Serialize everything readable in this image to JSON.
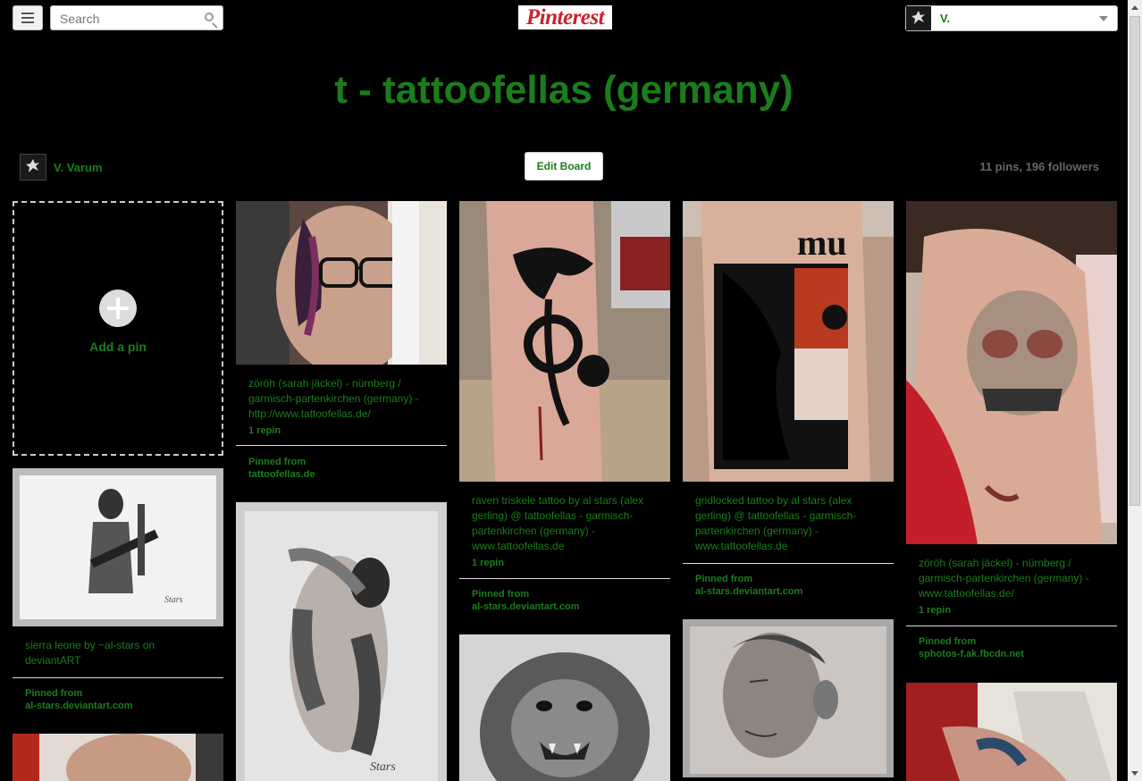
{
  "header": {
    "search_placeholder": "Search",
    "logo_text": "Pinterest",
    "user_menu_name": "V."
  },
  "board": {
    "title": "t - tattoofellas (germany)",
    "owner_name": "V. Varum",
    "edit_label": "Edit Board",
    "stats": "11 pins, 196 followers"
  },
  "add_pin_label": "Add a pin",
  "pins": [
    {
      "description": "zöröh (sarah jäckel) - nürnberg / garmisch-partenkirchen (germany) - http://www.tattoofellas.de/",
      "repins": "1 repin",
      "pinned_from_label": "Pinned from",
      "pinned_from_source": "tattoofellas.de"
    },
    {
      "description": "raven triskele tattoo by al stars (alex gerling) @ tattoofellas - garmisch-partenkirchen (germany) - www.tattoofellas.de",
      "repins": "1 repin",
      "pinned_from_label": "Pinned from",
      "pinned_from_source": "al-stars.deviantart.com"
    },
    {
      "description": "gridlocked tattoo by al stars (alex gerling) @ tattoofellas - garmisch-partenkirchen (germany) - www.tattoofellas.de",
      "repins": "",
      "pinned_from_label": "Pinned from",
      "pinned_from_source": "al-stars.deviantart.com"
    },
    {
      "description": "zöröh (sarah jäckel) - nürnberg / garmisch-partenkirchen (germany) - www.tattoofellas.de/",
      "repins": "1 repin",
      "pinned_from_label": "Pinned from",
      "pinned_from_source": "sphotos-f.ak.fbcdn.net"
    },
    {
      "description": "sierra leone by ~al-stars on deviantART",
      "repins": "",
      "pinned_from_label": "Pinned from",
      "pinned_from_source": "al-stars.deviantart.com"
    }
  ],
  "icons": {
    "menu": "menu-icon",
    "search": "search-icon",
    "add": "plus-icon",
    "caret": "chevron-down-icon"
  },
  "colors": {
    "accent": "#1b7d1b",
    "brand": "#c8232c",
    "background": "#000000"
  }
}
